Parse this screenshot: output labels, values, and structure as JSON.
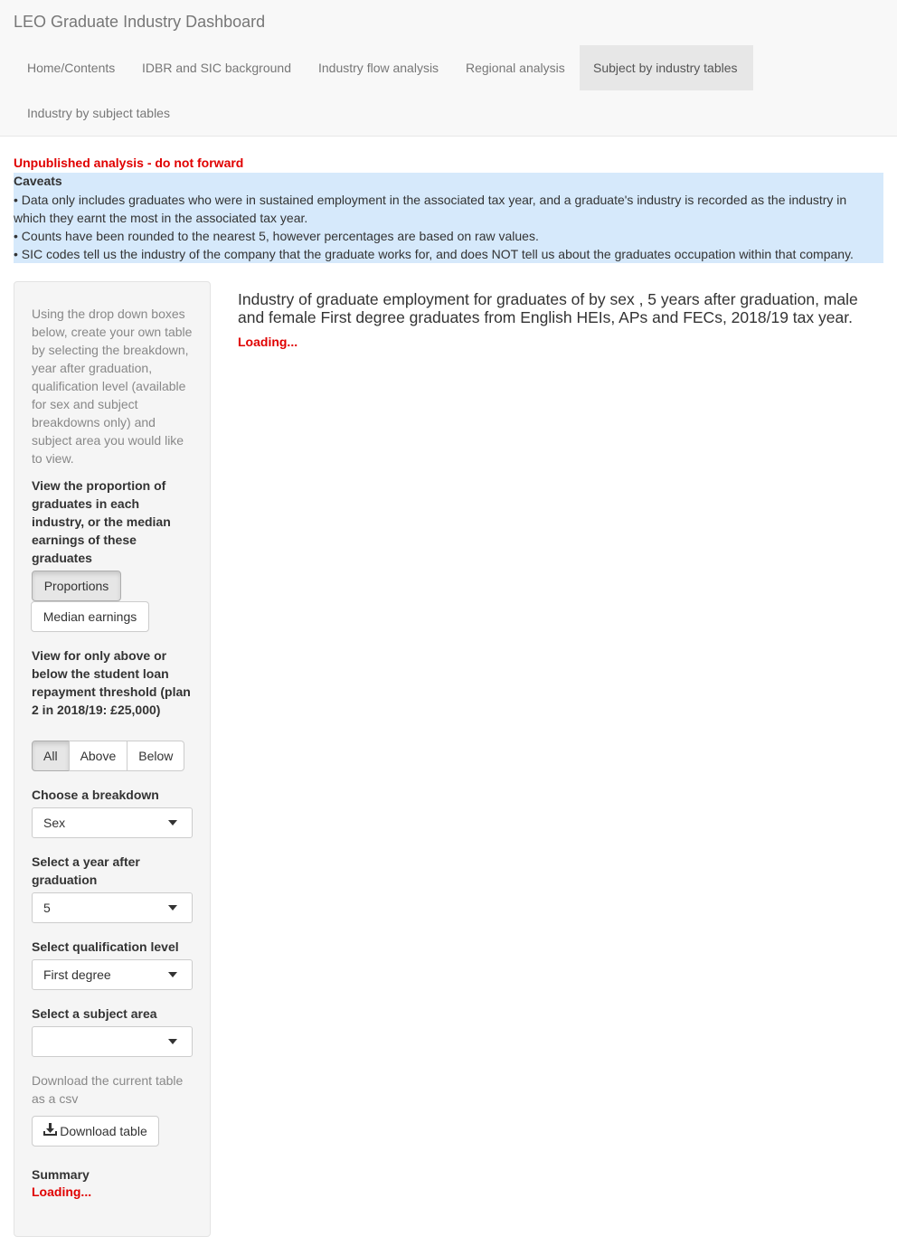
{
  "app": {
    "title": "LEO Graduate Industry Dashboard"
  },
  "nav": {
    "tabs": [
      {
        "label": "Home/Contents"
      },
      {
        "label": "IDBR and SIC background"
      },
      {
        "label": "Industry flow analysis"
      },
      {
        "label": "Regional analysis"
      },
      {
        "label": "Subject by industry tables"
      },
      {
        "label": "Industry by subject tables"
      }
    ],
    "active_tab": "Subject by industry tables"
  },
  "notice": {
    "unpublished": "Unpublished analysis - do not forward",
    "caveats_title": "Caveats",
    "caveats": [
      "• Data only includes graduates who were in sustained employment in the associated tax year, and a graduate's industry is recorded as the industry in",
      "which they earnt the most in the associated tax year.",
      "• Counts have been rounded to the nearest 5, however percentages are based on raw values.",
      "• SIC codes tell us the industry of the company that the graduate works for, and does NOT tell us about the graduates occupation within that company."
    ]
  },
  "sidebar": {
    "intro": "Using the drop down boxes below, create your own table by selecting the breakdown, year after graduation, qualification level (available for sex and subject breakdowns only) and subject area you would like to view.",
    "measure_label": "View the proportion of graduates in each industry, or the median earnings of these graduates",
    "measure_options": [
      "Proportions",
      "Median earnings"
    ],
    "measure_selected": "Proportions",
    "threshold_label": "View for only above or below the student loan repayment threshold (plan 2 in 2018/19: £25,000)",
    "threshold_options": [
      "All",
      "Above",
      "Below"
    ],
    "threshold_selected": "All",
    "breakdown_label": "Choose a breakdown",
    "breakdown_value": "Sex",
    "year_label": "Select a year after graduation",
    "year_value": "5",
    "qual_label": "Select qualification level",
    "qual_value": "First degree",
    "subject_label": "Select a subject area",
    "subject_value": "",
    "download_text": "Download the current table as a csv",
    "download_button": "Download table",
    "summary_label": "Summary",
    "summary_loading": "Loading..."
  },
  "main": {
    "title": "Industry of graduate employment for graduates of by sex , 5 years after graduation, male and female First degree graduates from English HEIs, APs and FECs, 2018/19 tax year.",
    "loading": "Loading..."
  },
  "colors": {
    "accent_red": "#e00000",
    "caveat_bg": "#d6e9fb",
    "navbar_bg": "#f8f8f8",
    "active_tab_bg": "#e7e7e7"
  }
}
